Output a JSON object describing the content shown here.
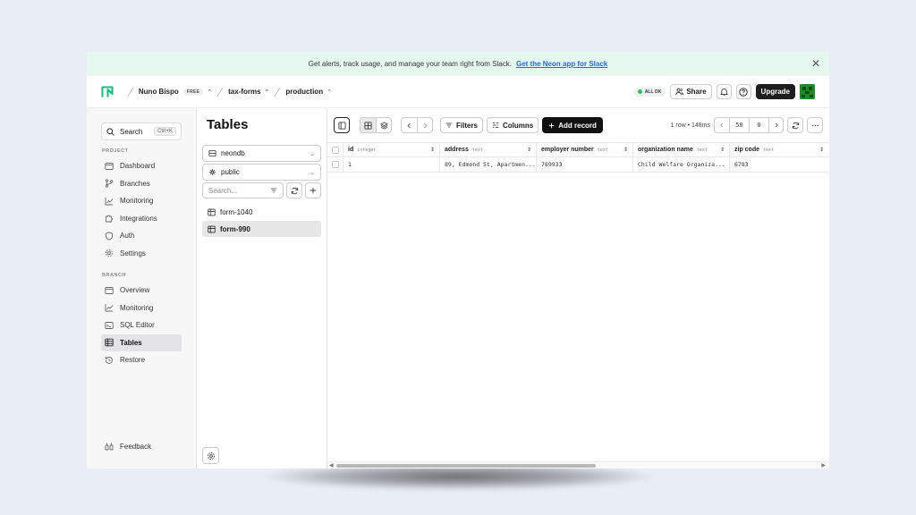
{
  "banner": {
    "text": "Get alerts, track usage, and manage your team right from Slack.",
    "link": "Get the Neon app for Slack",
    "close": "✕"
  },
  "header": {
    "org": "Nuno Bispo",
    "plan_badge": "FREE",
    "project": "tax-forms",
    "branch": "production",
    "status": "ALL OK",
    "share": "Share",
    "upgrade": "Upgrade"
  },
  "sidebar": {
    "search_label": "Search",
    "search_shortcut": "Ctrl+K",
    "project_label": "PROJECT",
    "project_items": [
      {
        "label": "Dashboard"
      },
      {
        "label": "Branches"
      },
      {
        "label": "Monitoring"
      },
      {
        "label": "Integrations"
      },
      {
        "label": "Auth"
      },
      {
        "label": "Settings"
      }
    ],
    "branch_label": "BRANCH",
    "branch_items": [
      {
        "label": "Overview"
      },
      {
        "label": "Monitoring"
      },
      {
        "label": "SQL Editor"
      },
      {
        "label": "Tables"
      },
      {
        "label": "Restore"
      }
    ],
    "feedback": "Feedback"
  },
  "tables_panel": {
    "title": "Tables",
    "database": "neondb",
    "schema": "public",
    "search_placeholder": "Search...",
    "tables": [
      {
        "name": "form-1040"
      },
      {
        "name": "form-990"
      }
    ]
  },
  "toolbar": {
    "filters": "Filters",
    "columns": "Columns",
    "add_record": "Add record",
    "row_info": "1 row • 148ms",
    "limit": "50",
    "offset": "0"
  },
  "grid": {
    "columns": [
      {
        "name": "id",
        "type": "integer"
      },
      {
        "name": "address",
        "type": "text"
      },
      {
        "name": "employer number",
        "type": "text"
      },
      {
        "name": "organization name",
        "type": "text"
      },
      {
        "name": "zip code",
        "type": "text"
      }
    ],
    "rows": [
      [
        "1",
        "89, Edmond St, Apartmen...",
        "789933",
        "Child Welfare Organiza...",
        "6783"
      ]
    ]
  },
  "colors": {
    "banner_bg": "#e6f9ef",
    "link": "#1b6ef3",
    "status_ok": "#2fc05a",
    "primary_btn": "#111111",
    "logo": "#00c27a"
  }
}
